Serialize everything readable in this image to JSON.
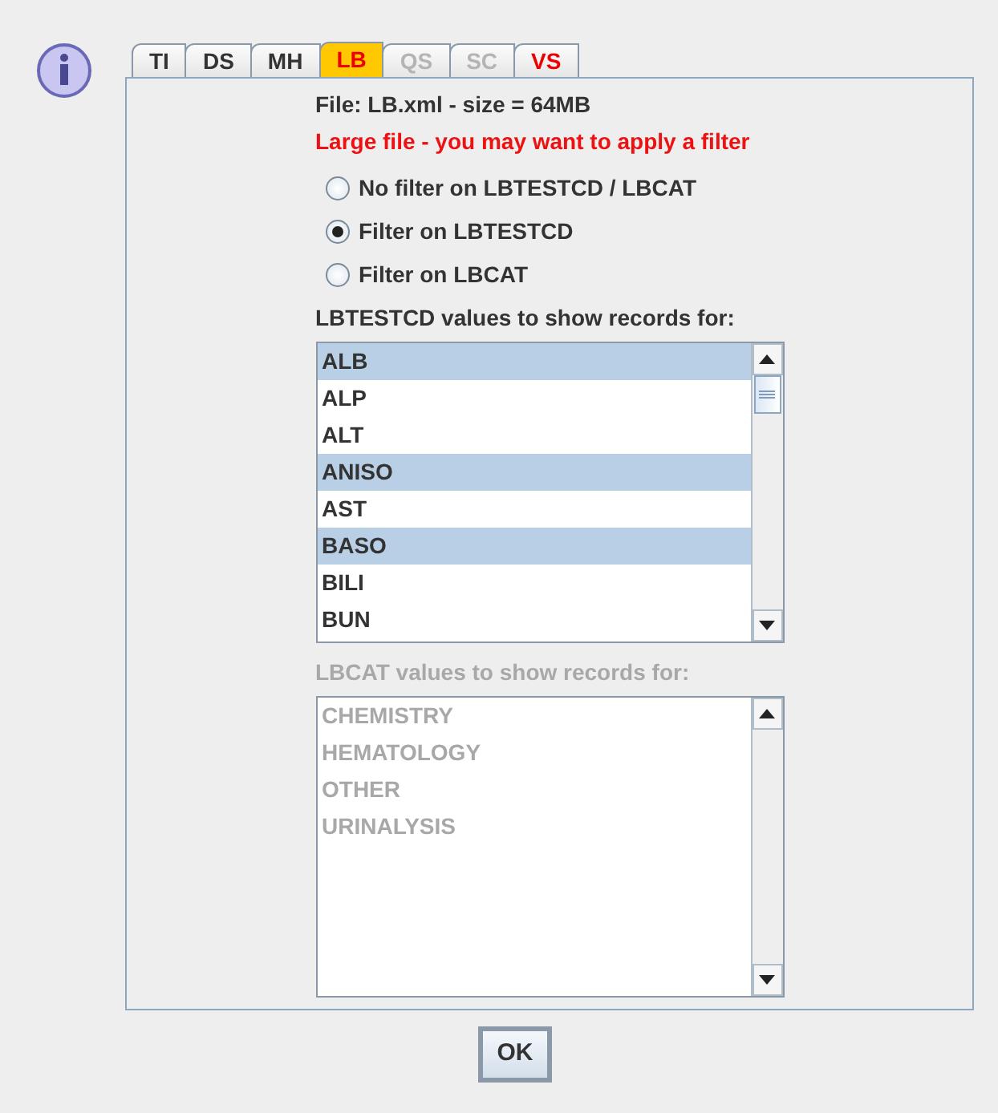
{
  "tabs": [
    {
      "label": "TI",
      "selected": false,
      "disabled": false,
      "flagged": false
    },
    {
      "label": "DS",
      "selected": false,
      "disabled": false,
      "flagged": false
    },
    {
      "label": "MH",
      "selected": false,
      "disabled": false,
      "flagged": false
    },
    {
      "label": "LB",
      "selected": true,
      "disabled": false,
      "flagged": true
    },
    {
      "label": "QS",
      "selected": false,
      "disabled": true,
      "flagged": false
    },
    {
      "label": "SC",
      "selected": false,
      "disabled": true,
      "flagged": false
    },
    {
      "label": "VS",
      "selected": false,
      "disabled": false,
      "flagged": true
    }
  ],
  "file_info": "File: LB.xml - size = 64MB",
  "warning": "Large file - you may want to apply a filter",
  "filter_options": [
    {
      "label": "No filter on LBTESTCD / LBCAT",
      "selected": false
    },
    {
      "label": "Filter on LBTESTCD",
      "selected": true
    },
    {
      "label": "Filter on LBCAT",
      "selected": false
    }
  ],
  "lists": [
    {
      "heading": "LBTESTCD values to show records for:",
      "disabled": false,
      "items": [
        {
          "label": "ALB",
          "selected": true
        },
        {
          "label": "ALP",
          "selected": false
        },
        {
          "label": "ALT",
          "selected": false
        },
        {
          "label": "ANISO",
          "selected": true
        },
        {
          "label": "AST",
          "selected": false
        },
        {
          "label": "BASO",
          "selected": true
        },
        {
          "label": "BILI",
          "selected": false
        },
        {
          "label": "BUN",
          "selected": false
        }
      ]
    },
    {
      "heading": "LBCAT values to show records for:",
      "disabled": true,
      "items": [
        {
          "label": "CHEMISTRY",
          "selected": false
        },
        {
          "label": "HEMATOLOGY",
          "selected": false
        },
        {
          "label": "OTHER",
          "selected": false
        },
        {
          "label": "URINALYSIS",
          "selected": false
        }
      ]
    }
  ],
  "buttons": [
    "OK"
  ]
}
